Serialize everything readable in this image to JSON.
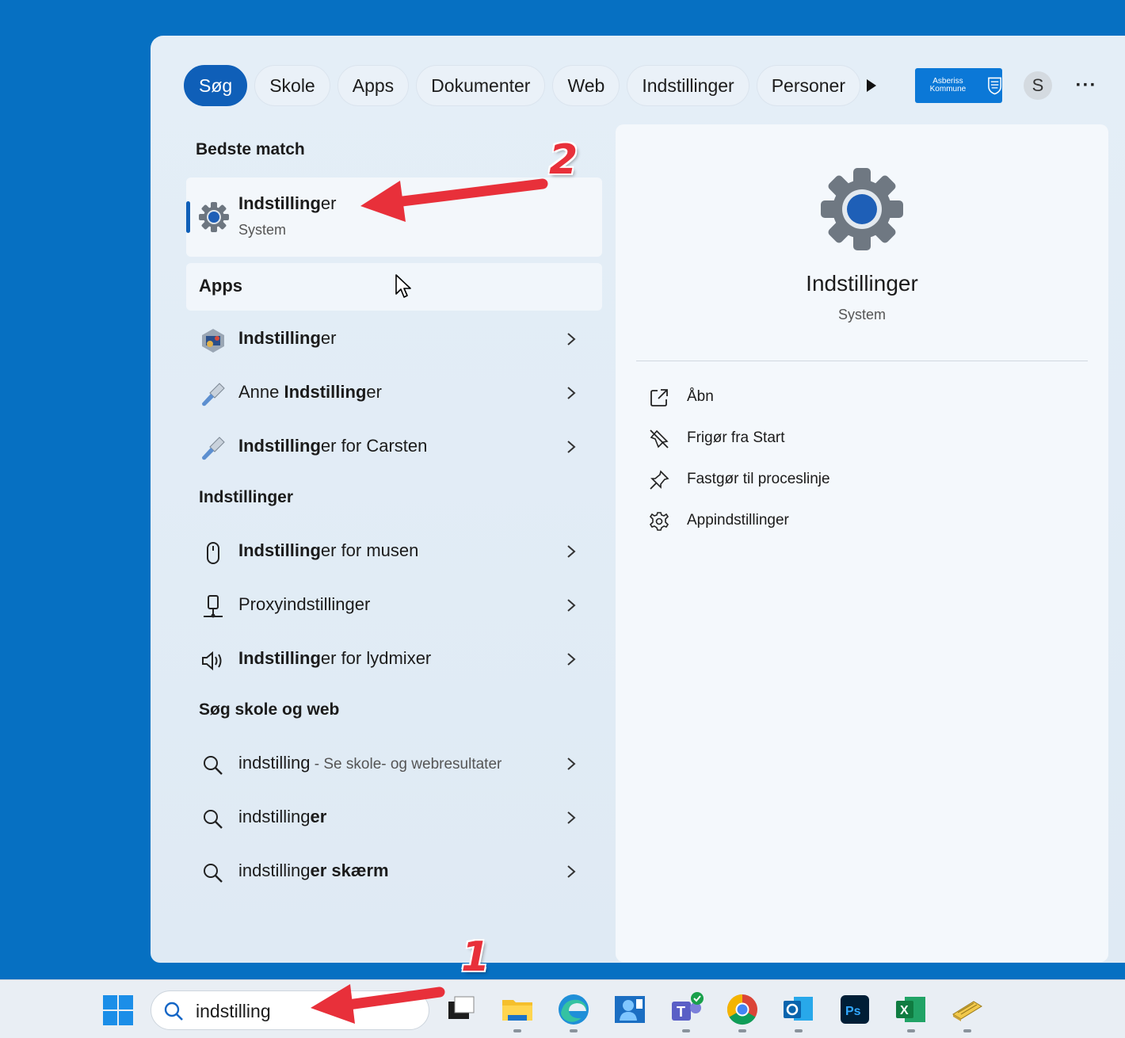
{
  "filters": {
    "items": [
      "Søg",
      "Skole",
      "Apps",
      "Dokumenter",
      "Web",
      "Indstillinger",
      "Personer"
    ],
    "active_index": 0
  },
  "header": {
    "org_logo_text": "Asberiss Kommune",
    "avatar_initial": "S",
    "more_label": "···"
  },
  "best_match": {
    "heading": "Bedste match",
    "title_bold": "Indstilling",
    "title_rest": "er",
    "subtitle": "System",
    "icon": "gear-icon"
  },
  "apps": {
    "heading": "Apps",
    "items": [
      {
        "pre": "",
        "bold": "Indstilling",
        "post": "er",
        "icon": "control-panel-icon"
      },
      {
        "pre": "Anne ",
        "bold": "Indstilling",
        "post": "er",
        "icon": "screwdriver-icon"
      },
      {
        "pre": "",
        "bold": "Indstilling",
        "post": "er for Carsten",
        "icon": "screwdriver-icon"
      }
    ]
  },
  "settings": {
    "heading": "Indstillinger",
    "items": [
      {
        "pre": "",
        "bold": "Indstilling",
        "post": "er for musen",
        "icon": "mouse-icon"
      },
      {
        "pre": "Proxyindstillinger",
        "bold": "",
        "post": "",
        "icon": "proxy-icon"
      },
      {
        "pre": "",
        "bold": "Indstilling",
        "post": "er for lydmixer",
        "icon": "speaker-icon"
      }
    ]
  },
  "web": {
    "heading": "Søg skole og web",
    "items": [
      {
        "pre": "indstilling",
        "bold": "",
        "post": "",
        "hint": " - Se skole- og webresultater",
        "icon": "search-icon"
      },
      {
        "pre": "indstilling",
        "bold": "er",
        "post": "",
        "hint": "",
        "icon": "search-icon"
      },
      {
        "pre": "indstilling",
        "bold": "er skærm",
        "post": "",
        "hint": "",
        "icon": "search-icon"
      }
    ]
  },
  "detail": {
    "title": "Indstillinger",
    "subtitle": "System",
    "actions": [
      {
        "label": "Åbn",
        "icon": "open-external-icon"
      },
      {
        "label": "Frigør fra Start",
        "icon": "unpin-icon"
      },
      {
        "label": "Fastgør til proceslinje",
        "icon": "pin-icon"
      },
      {
        "label": "Appindstillinger",
        "icon": "settings-gear-icon"
      }
    ]
  },
  "taskbar": {
    "search_value": "indstilling",
    "apps": [
      "task-view-icon",
      "file-explorer-icon",
      "edge-icon",
      "company-portal-icon",
      "teams-icon",
      "chrome-icon",
      "outlook-icon",
      "photoshop-icon",
      "excel-icon",
      "notes-icon"
    ]
  },
  "annotations": {
    "step1": "1",
    "step2": "2"
  },
  "colors": {
    "desktop": "#0670c2",
    "accent": "#0f5fb8",
    "annotation": "#e8303a"
  }
}
